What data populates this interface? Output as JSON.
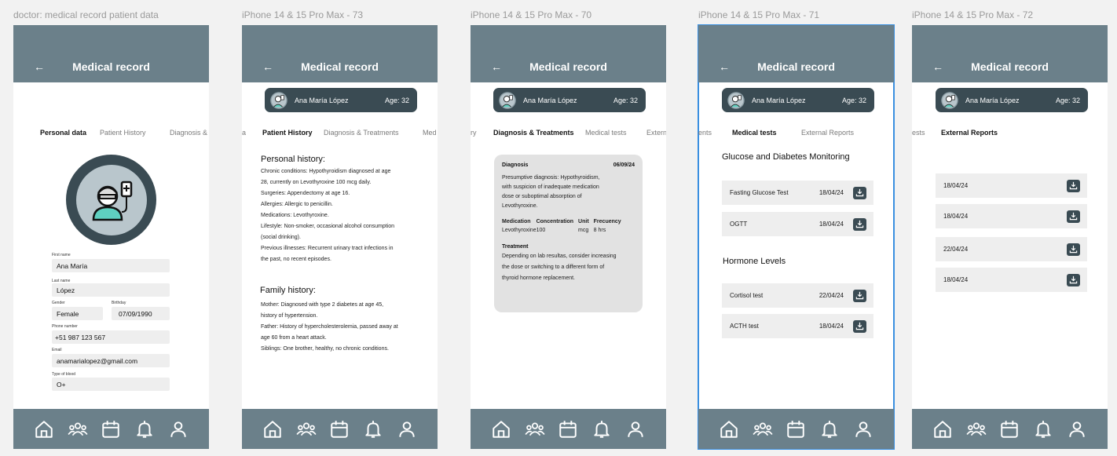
{
  "frames": [
    {
      "label": "doctor: medical record patient data"
    },
    {
      "label": "iPhone 14 & 15 Pro Max - 73"
    },
    {
      "label": "iPhone 14 & 15 Pro Max - 70"
    },
    {
      "label": "iPhone 14 & 15 Pro Max - 71"
    },
    {
      "label": "iPhone 14 & 15 Pro Max - 72"
    }
  ],
  "appbar": {
    "title": "Medical record",
    "back_icon": "←"
  },
  "patient": {
    "name": "Ana María López",
    "age": "Age: 32"
  },
  "tabs": {
    "personal": "Personal data",
    "history": "Patient History",
    "diagnosis": "Diagnosis & Treatments",
    "diagnosis_cut": "Diagnosis & T",
    "tests": "Medical tests",
    "external": "External Reports",
    "a_cut": "a",
    "med_cut": "Med",
    "ry_cut": "ry",
    "exter_cut": "Extern",
    "ents_cut": "ents",
    "ests_cut": "ests"
  },
  "personal_data": {
    "first_name_label": "First name",
    "first_name": "Ana María",
    "last_name_label": "Last name",
    "last_name": "López",
    "gender_label": "Gender",
    "gender": "Female",
    "birthday_label": "Birthday",
    "birthday": "07/09/1990",
    "phone_label": "Phone number",
    "phone": "+51 987 123 567",
    "email_label": "Email",
    "email": "anamarialopez@gmail.com",
    "blood_label": "Type of blood",
    "blood": "O+"
  },
  "history": {
    "personal_title": "Personal history:",
    "personal_lines": [
      "Chronic conditions: Hypothyroidism diagnosed at age",
      "28, currently on Levothyroxine 100 mcg daily.",
      "Surgeries: Appendectomy at age 16.",
      "Allergies: Allergic to penicillin.",
      "Medications: Levothyroxine.",
      "Lifestyle: Non-smoker, occasional alcohol consumption",
      "(social drinking).",
      "Previous illnesses: Recurrent urinary tract infections in",
      "the past, no recent episodes."
    ],
    "family_title": "Family history:",
    "family_lines": [
      "Mother: Diagnosed with type 2 diabetes at age 45,",
      "history of hypertension.",
      "Father: History of hypercholesterolemia, passed away at",
      "age 60 from a heart attack.",
      "Siblings: One brother, healthy, no chronic conditions."
    ]
  },
  "diagnosis": {
    "title": "Diagnosis",
    "date": "06/09/24",
    "lines": [
      "Presumptive diagnosis: Hypothyroidism,",
      "with suspicion of inadequate medication",
      "dose or suboptimal absorption of",
      "Levothyroxine."
    ],
    "med_headers": [
      "Medication",
      "Concentration",
      "Unit",
      "Frecuency"
    ],
    "med_row": [
      "Levothyroxine",
      "100",
      "mcg",
      "8 hrs"
    ],
    "treatment_title": "Treatment",
    "treatment_lines": [
      "Depending on lab resultas, consider increasing",
      "the dose or switching to a different form of",
      "thyroid hormone replacement."
    ]
  },
  "tests": {
    "glucose_title": "Glucose and Diabetes Monitoring",
    "glucose": [
      {
        "name": "Fasting Glucose Test",
        "date": "18/04/24"
      },
      {
        "name": "OGTT",
        "date": "18/04/24"
      }
    ],
    "hormone_title": "Hormone Levels",
    "hormone": [
      {
        "name": "Cortisol test",
        "date": "22/04/24"
      },
      {
        "name": "ACTH test",
        "date": "18/04/24"
      }
    ]
  },
  "external_reports": [
    {
      "date": "18/04/24"
    },
    {
      "date": "18/04/24"
    },
    {
      "date": "22/04/24"
    },
    {
      "date": "18/04/24"
    }
  ],
  "colors": {
    "header": "#6b808a",
    "dark": "#3a4b53",
    "selected_outline": "#3a8fe0"
  },
  "icons": [
    "home-icon",
    "patients-icon",
    "calendar-icon",
    "bell-icon",
    "profile-icon",
    "download-icon",
    "back-arrow-icon",
    "doctor-avatar-icon"
  ]
}
